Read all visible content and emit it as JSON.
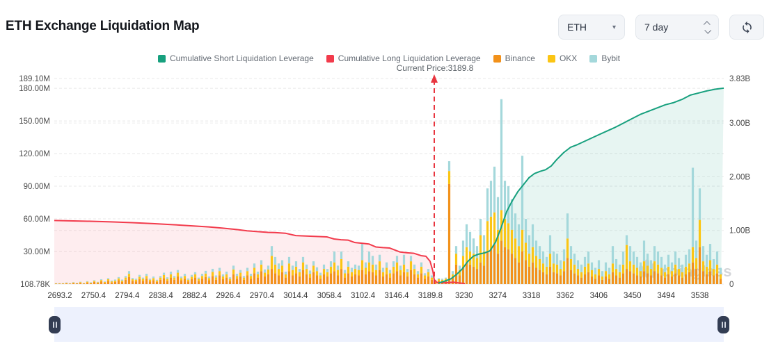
{
  "header": {
    "title": "ETH Exchange Liquidation Map"
  },
  "controls": {
    "symbol_select": {
      "value": "ETH"
    },
    "period_select": {
      "value": "7 day"
    },
    "refresh_icon": "refresh-sync-icon"
  },
  "watermark": {
    "text": "coinglass"
  },
  "chart_data": {
    "type": "bar",
    "title": "ETH Exchange Liquidation Map",
    "legend": [
      {
        "label": "Cumulative Short Liquidation Leverage",
        "color": "#17a07e"
      },
      {
        "label": "Cumulative Long Liquidation Leverage",
        "color": "#f23b4c"
      },
      {
        "label": "Binance",
        "color": "#f2911a"
      },
      {
        "label": "OKX",
        "color": "#fbc514"
      },
      {
        "label": "Bybit",
        "color": "#a4d8db"
      }
    ],
    "annotation": {
      "text": "Current Price:3189.8",
      "price": 3189.8
    },
    "left_axis": {
      "unit": "M",
      "labels": [
        "189.10M",
        "180.00M",
        "150.00M",
        "120.00M",
        "90.00M",
        "60.00M",
        "30.00M",
        "108.78K"
      ],
      "values": [
        189.1,
        180,
        150,
        120,
        90,
        60,
        30,
        0
      ],
      "max": 189.1
    },
    "right_axis": {
      "unit": "B",
      "labels": [
        "3.83B",
        "3.00B",
        "2.00B",
        "1.00B",
        "0"
      ],
      "values": [
        3.83,
        3.0,
        2.0,
        1.0,
        0
      ],
      "max": 3.83
    },
    "x_axis": {
      "labels": [
        "2693.2",
        "2750.4",
        "2794.4",
        "2838.4",
        "2882.4",
        "2926.4",
        "2970.4",
        "3014.4",
        "3058.4",
        "3102.4",
        "3146.4",
        "3189.8",
        "3230",
        "3274",
        "3318",
        "3362",
        "3406",
        "3450",
        "3494",
        "3538"
      ]
    },
    "grid": true,
    "legend_position": "top",
    "stack_order": [
      "Binance",
      "OKX",
      "Bybit"
    ],
    "bars_unit": "M",
    "bars": [
      [
        0.3,
        0.2,
        0.1
      ],
      [
        0.5,
        0.3,
        0.2
      ],
      [
        0.2,
        0.1,
        0.1
      ],
      [
        0.8,
        0.4,
        0.2
      ],
      [
        0.4,
        0.2,
        0.3
      ],
      [
        1.0,
        0.5,
        0.3
      ],
      [
        0.6,
        0.3,
        0.2
      ],
      [
        1.2,
        0.6,
        0.4
      ],
      [
        0.5,
        0.4,
        0.3
      ],
      [
        1.5,
        0.7,
        0.5
      ],
      [
        0.8,
        0.5,
        0.4
      ],
      [
        2.0,
        1.0,
        0.6
      ],
      [
        1.0,
        0.6,
        0.5
      ],
      [
        2.5,
        1.2,
        0.8
      ],
      [
        1.2,
        0.8,
        0.6
      ],
      [
        3.0,
        1.5,
        1.0
      ],
      [
        1.5,
        1.0,
        0.8
      ],
      [
        2.0,
        1.2,
        1.0
      ],
      [
        3.5,
        1.8,
        1.2
      ],
      [
        2.0,
        1.2,
        1.0
      ],
      [
        4.0,
        2.0,
        1.5
      ],
      [
        6.5,
        3.0,
        2.5
      ],
      [
        3.0,
        1.5,
        1.2
      ],
      [
        2.5,
        1.5,
        1.0
      ],
      [
        4.5,
        2.2,
        1.8
      ],
      [
        3.0,
        1.8,
        1.2
      ],
      [
        5.0,
        2.5,
        2.0
      ],
      [
        2.5,
        1.5,
        1.0
      ],
      [
        3.5,
        2.0,
        1.5
      ],
      [
        2.0,
        1.2,
        0.8
      ],
      [
        4.0,
        2.0,
        1.5
      ],
      [
        5.5,
        2.8,
        2.2
      ],
      [
        3.0,
        1.8,
        1.5
      ],
      [
        6.0,
        3.0,
        2.5
      ],
      [
        4.0,
        2.0,
        1.5
      ],
      [
        7.0,
        3.5,
        2.5
      ],
      [
        3.5,
        2.0,
        1.5
      ],
      [
        5.0,
        2.5,
        2.0
      ],
      [
        2.5,
        1.5,
        1.2
      ],
      [
        4.5,
        2.2,
        1.8
      ],
      [
        6.0,
        3.0,
        2.0
      ],
      [
        3.0,
        1.8,
        1.2
      ],
      [
        5.0,
        2.5,
        2.0
      ],
      [
        6.5,
        3.2,
        2.5
      ],
      [
        3.5,
        2.0,
        1.5
      ],
      [
        7.5,
        3.8,
        2.8
      ],
      [
        4.0,
        2.2,
        1.8
      ],
      [
        8.0,
        4.0,
        3.0
      ],
      [
        4.5,
        2.5,
        2.0
      ],
      [
        6.0,
        3.0,
        2.5
      ],
      [
        3.0,
        1.8,
        1.5
      ],
      [
        9.0,
        4.5,
        3.5
      ],
      [
        5.0,
        2.5,
        2.0
      ],
      [
        7.0,
        3.5,
        2.5
      ],
      [
        4.0,
        2.0,
        1.5
      ],
      [
        8.0,
        4.0,
        3.0
      ],
      [
        5.0,
        2.5,
        2.0
      ],
      [
        10.0,
        5.0,
        4.0
      ],
      [
        6.0,
        3.0,
        2.5
      ],
      [
        12.0,
        6.0,
        4.0
      ],
      [
        7.0,
        3.5,
        3.0
      ],
      [
        9.0,
        4.5,
        3.5
      ],
      [
        14.0,
        12.0,
        9.0
      ],
      [
        10.0,
        8.0,
        7.0
      ],
      [
        8.0,
        6.0,
        5.0
      ],
      [
        11.0,
        6.0,
        5.0
      ],
      [
        6.0,
        3.0,
        2.5
      ],
      [
        12.0,
        7.0,
        6.0
      ],
      [
        8.0,
        5.0,
        4.0
      ],
      [
        10.0,
        6.0,
        5.0
      ],
      [
        7.0,
        4.0,
        3.0
      ],
      [
        13.0,
        7.0,
        5.0
      ],
      [
        9.0,
        5.0,
        4.0
      ],
      [
        6.0,
        3.5,
        3.0
      ],
      [
        11.0,
        6.0,
        4.0
      ],
      [
        8.0,
        4.0,
        3.5
      ],
      [
        5.0,
        3.0,
        2.5
      ],
      [
        9.0,
        5.0,
        4.0
      ],
      [
        7.0,
        4.0,
        3.0
      ],
      [
        10.0,
        6.0,
        5.0
      ],
      [
        12.0,
        8.0,
        10.0
      ],
      [
        8.0,
        5.0,
        4.0
      ],
      [
        14.0,
        9.0,
        7.0
      ],
      [
        6.0,
        4.0,
        3.0
      ],
      [
        10.0,
        6.0,
        5.0
      ],
      [
        7.0,
        4.0,
        4.0
      ],
      [
        9.0,
        5.0,
        4.0
      ],
      [
        8.0,
        5.0,
        4.0
      ],
      [
        13.0,
        9.0,
        15.0
      ],
      [
        9.0,
        6.0,
        5.0
      ],
      [
        12.0,
        8.0,
        10.0
      ],
      [
        11.0,
        7.0,
        8.0
      ],
      [
        8.0,
        5.0,
        5.0
      ],
      [
        13.0,
        8.0,
        6.0
      ],
      [
        7.0,
        4.0,
        4.0
      ],
      [
        9.0,
        6.0,
        5.0
      ],
      [
        6.0,
        4.0,
        3.0
      ],
      [
        10.0,
        6.0,
        5.0
      ],
      [
        12.0,
        8.0,
        6.0
      ],
      [
        8.0,
        5.0,
        4.0
      ],
      [
        11.0,
        7.0,
        9.0
      ],
      [
        7.0,
        4.0,
        3.0
      ],
      [
        13.0,
        8.0,
        5.0
      ],
      [
        9.0,
        5.0,
        4.0
      ],
      [
        6.0,
        3.0,
        3.0
      ],
      [
        10.0,
        6.0,
        4.0
      ],
      [
        5.0,
        3.0,
        2.0
      ],
      [
        7.0,
        4.0,
        3.0
      ],
      [
        4.0,
        2.0,
        2.0
      ],
      [
        2.0,
        1.0,
        1.0
      ],
      [
        3.0,
        1.5,
        1.0
      ],
      [
        2.5,
        1.5,
        1.0
      ],
      [
        3.0,
        2.0,
        1.0
      ],
      [
        92.0,
        12.0,
        9.0
      ],
      [
        6.0,
        3.0,
        3.0
      ],
      [
        18.0,
        10.0,
        7.0
      ],
      [
        8.0,
        5.0,
        4.0
      ],
      [
        16.0,
        10.0,
        14.0
      ],
      [
        20.0,
        14.0,
        21.0
      ],
      [
        18.0,
        12.0,
        18.0
      ],
      [
        16.0,
        12.0,
        14.0
      ],
      [
        14.0,
        10.0,
        11.0
      ],
      [
        20.0,
        25.0,
        15.0
      ],
      [
        17.0,
        13.0,
        15.0
      ],
      [
        30.0,
        28.0,
        30.0
      ],
      [
        32.0,
        30.0,
        33.0
      ],
      [
        36.0,
        30.0,
        42.0
      ],
      [
        28.0,
        22.0,
        30.0
      ],
      [
        40.0,
        28.0,
        102.0
      ],
      [
        34.0,
        26.0,
        35.0
      ],
      [
        32.0,
        24.0,
        34.0
      ],
      [
        28.0,
        22.0,
        28.0
      ],
      [
        24.0,
        18.0,
        23.0
      ],
      [
        20.0,
        15.0,
        20.0
      ],
      [
        30.0,
        20.0,
        68.0
      ],
      [
        22.0,
        16.0,
        22.0
      ],
      [
        16.0,
        12.0,
        17.0
      ],
      [
        20.0,
        14.0,
        21.0
      ],
      [
        15.0,
        11.0,
        14.0
      ],
      [
        13.0,
        10.0,
        12.0
      ],
      [
        11.0,
        8.0,
        11.0
      ],
      [
        9.0,
        7.0,
        9.0
      ],
      [
        16.0,
        12.0,
        17.0
      ],
      [
        11.0,
        8.0,
        11.0
      ],
      [
        10.0,
        8.0,
        10.0
      ],
      [
        8.0,
        6.0,
        8.0
      ],
      [
        12.0,
        9.0,
        11.0
      ],
      [
        24.0,
        18.0,
        23.0
      ],
      [
        13.0,
        10.0,
        12.0
      ],
      [
        10.0,
        8.0,
        10.0
      ],
      [
        8.0,
        6.0,
        8.0
      ],
      [
        6.0,
        5.0,
        7.0
      ],
      [
        9.0,
        7.0,
        9.0
      ],
      [
        11.0,
        8.0,
        11.0
      ],
      [
        7.0,
        6.0,
        7.0
      ],
      [
        5.0,
        4.0,
        6.0
      ],
      [
        8.0,
        6.0,
        8.0
      ],
      [
        4.0,
        3.0,
        5.0
      ],
      [
        7.0,
        5.0,
        8.0
      ],
      [
        5.0,
        4.0,
        6.0
      ],
      [
        11.0,
        8.0,
        16.0
      ],
      [
        8.0,
        6.0,
        9.0
      ],
      [
        6.0,
        5.0,
        7.0
      ],
      [
        10.0,
        8.0,
        12.0
      ],
      [
        14.0,
        22.0,
        9.0
      ],
      [
        12.0,
        9.0,
        14.0
      ],
      [
        10.0,
        8.0,
        12.0
      ],
      [
        8.0,
        7.0,
        10.0
      ],
      [
        7.0,
        5.0,
        8.0
      ],
      [
        12.0,
        9.0,
        19.0
      ],
      [
        10.0,
        7.0,
        11.0
      ],
      [
        8.0,
        6.0,
        8.0
      ],
      [
        12.0,
        9.0,
        14.0
      ],
      [
        10.0,
        8.0,
        12.0
      ],
      [
        8.0,
        7.0,
        10.0
      ],
      [
        6.0,
        5.0,
        7.0
      ],
      [
        9.0,
        7.0,
        11.0
      ],
      [
        7.0,
        5.0,
        8.0
      ],
      [
        10.0,
        8.0,
        12.0
      ],
      [
        8.0,
        6.0,
        10.0
      ],
      [
        6.0,
        5.0,
        7.0
      ],
      [
        9.0,
        7.0,
        11.0
      ],
      [
        11.0,
        8.0,
        13.0
      ],
      [
        20.0,
        14.0,
        73.0
      ],
      [
        14.0,
        10.0,
        16.0
      ],
      [
        34.0,
        25.0,
        29.0
      ],
      [
        12.0,
        9.0,
        14.0
      ],
      [
        9.0,
        7.0,
        11.0
      ],
      [
        12.0,
        10.0,
        15.0
      ],
      [
        8.0,
        6.0,
        9.0
      ],
      [
        10.0,
        8.0,
        12.0
      ],
      [
        5.0,
        4.0,
        6.0
      ]
    ],
    "series": [
      {
        "name": "Cumulative Long Liquidation Leverage",
        "axis": "left",
        "unit": "M",
        "color": "#f23b4c",
        "points": [
          [
            78,
            58.5
          ],
          [
            100,
            58.2
          ],
          [
            130,
            57.8
          ],
          [
            160,
            57.2
          ],
          [
            190,
            56.5
          ],
          [
            220,
            55.6
          ],
          [
            250,
            54.6
          ],
          [
            280,
            53.4
          ],
          [
            300,
            52.6
          ],
          [
            320,
            51.5
          ],
          [
            340,
            50.2
          ],
          [
            355,
            49.0
          ],
          [
            370,
            48.3
          ],
          [
            385,
            47.6
          ],
          [
            395,
            47.4
          ],
          [
            410,
            46.8
          ],
          [
            425,
            44.6
          ],
          [
            440,
            44.2
          ],
          [
            455,
            43.8
          ],
          [
            470,
            43.4
          ],
          [
            480,
            41.5
          ],
          [
            490,
            40.8
          ],
          [
            500,
            40.5
          ],
          [
            510,
            38.2
          ],
          [
            520,
            37.6
          ],
          [
            530,
            36.9
          ],
          [
            540,
            34.2
          ],
          [
            550,
            33.6
          ],
          [
            560,
            33.2
          ],
          [
            575,
            29.5
          ],
          [
            585,
            28.8
          ],
          [
            595,
            28.3
          ],
          [
            605,
            26.2
          ],
          [
            612,
            25.6
          ],
          [
            618,
            21.0
          ],
          [
            622,
            12.0
          ],
          [
            624,
            4.0
          ],
          [
            628,
            1.5
          ],
          [
            640,
            1.2
          ],
          [
            652,
            1.8
          ],
          [
            660,
            1.0
          ],
          [
            668,
            0.6
          ]
        ]
      },
      {
        "name": "Cumulative Short Liquidation Leverage",
        "axis": "right",
        "unit": "B",
        "color": "#17a07e",
        "points": [
          [
            630,
            0.02
          ],
          [
            640,
            0.06
          ],
          [
            648,
            0.1
          ],
          [
            656,
            0.18
          ],
          [
            664,
            0.28
          ],
          [
            672,
            0.42
          ],
          [
            680,
            0.52
          ],
          [
            688,
            0.56
          ],
          [
            696,
            0.58
          ],
          [
            704,
            0.62
          ],
          [
            712,
            0.78
          ],
          [
            720,
            1.05
          ],
          [
            728,
            1.35
          ],
          [
            736,
            1.55
          ],
          [
            744,
            1.72
          ],
          [
            752,
            1.85
          ],
          [
            760,
            1.98
          ],
          [
            768,
            2.06
          ],
          [
            776,
            2.1
          ],
          [
            784,
            2.13
          ],
          [
            792,
            2.2
          ],
          [
            800,
            2.32
          ],
          [
            810,
            2.45
          ],
          [
            820,
            2.55
          ],
          [
            830,
            2.6
          ],
          [
            840,
            2.66
          ],
          [
            850,
            2.72
          ],
          [
            860,
            2.78
          ],
          [
            872,
            2.85
          ],
          [
            884,
            2.92
          ],
          [
            896,
            3.0
          ],
          [
            908,
            3.08
          ],
          [
            920,
            3.16
          ],
          [
            932,
            3.22
          ],
          [
            944,
            3.28
          ],
          [
            956,
            3.34
          ],
          [
            968,
            3.38
          ],
          [
            980,
            3.44
          ],
          [
            992,
            3.52
          ],
          [
            1004,
            3.56
          ],
          [
            1016,
            3.6
          ],
          [
            1028,
            3.63
          ],
          [
            1040,
            3.65
          ]
        ]
      }
    ]
  }
}
